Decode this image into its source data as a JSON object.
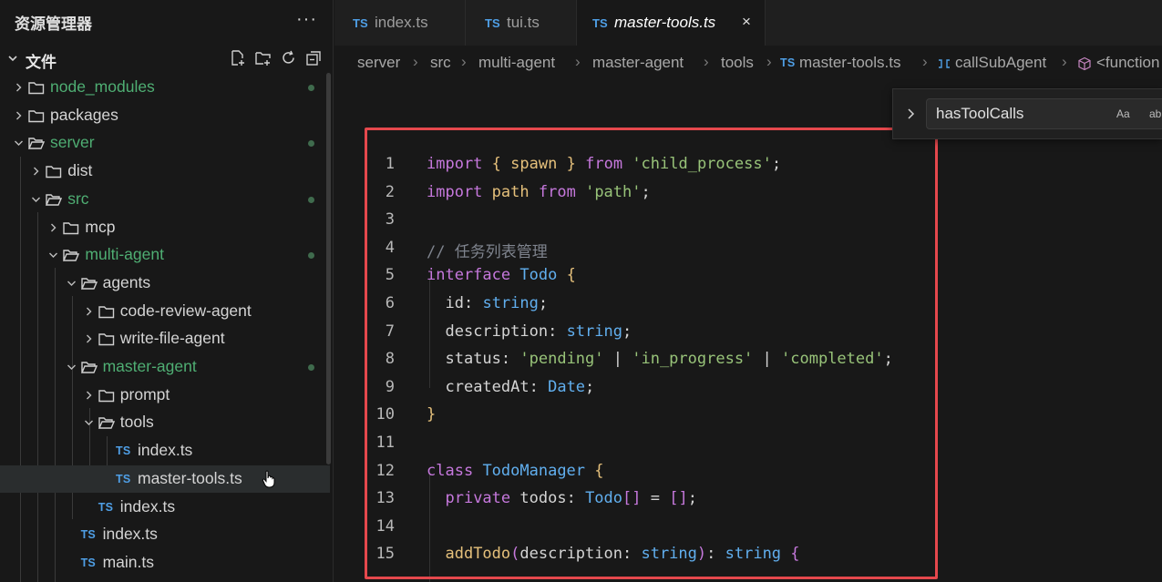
{
  "sidebar": {
    "title": "资源管理器",
    "more": "···",
    "section_label": "文件",
    "items": [
      {
        "label": "node_modules",
        "type": "folder",
        "expanded": false,
        "green": true,
        "dot": true
      },
      {
        "label": "packages",
        "type": "folder",
        "expanded": false,
        "green": false,
        "dot": false
      },
      {
        "label": "server",
        "type": "folder",
        "expanded": true,
        "green": true,
        "dot": true
      },
      {
        "label": "dist",
        "type": "folder",
        "expanded": false,
        "green": false,
        "dot": false
      },
      {
        "label": "src",
        "type": "folder",
        "expanded": true,
        "green": true,
        "dot": true
      },
      {
        "label": "mcp",
        "type": "folder",
        "expanded": false,
        "green": false,
        "dot": false
      },
      {
        "label": "multi-agent",
        "type": "folder",
        "expanded": true,
        "green": true,
        "dot": true
      },
      {
        "label": "agents",
        "type": "folder",
        "expanded": true,
        "green": false,
        "dot": false
      },
      {
        "label": "code-review-agent",
        "type": "folder",
        "expanded": false,
        "green": false,
        "dot": false
      },
      {
        "label": "write-file-agent",
        "type": "folder",
        "expanded": false,
        "green": false,
        "dot": false
      },
      {
        "label": "master-agent",
        "type": "folder",
        "expanded": true,
        "green": true,
        "dot": true
      },
      {
        "label": "prompt",
        "type": "folder",
        "expanded": false,
        "green": false,
        "dot": false
      },
      {
        "label": "tools",
        "type": "folder",
        "expanded": true,
        "green": false,
        "dot": false
      },
      {
        "label": "index.ts",
        "type": "file",
        "badge": "TS"
      },
      {
        "label": "master-tools.ts",
        "type": "file",
        "badge": "TS",
        "selected": true
      },
      {
        "label": "index.ts",
        "type": "file",
        "badge": "TS"
      },
      {
        "label": "index.ts",
        "type": "file",
        "badge": "TS"
      },
      {
        "label": "main.ts",
        "type": "file",
        "badge": "TS"
      }
    ]
  },
  "tabs": [
    {
      "badge": "TS",
      "label": "index.ts",
      "active": false
    },
    {
      "badge": "TS",
      "label": "tui.ts",
      "active": false
    },
    {
      "badge": "TS",
      "label": "master-tools.ts",
      "active": true,
      "close": "×"
    }
  ],
  "breadcrumb": [
    "server",
    "src",
    "multi-agent",
    "master-agent",
    "tools",
    "master-tools.ts",
    "callSubAgent",
    "<function"
  ],
  "breadcrumb_badge": "TS",
  "find": {
    "value": "hasToolCalls",
    "opt_case": "Aa",
    "opt_word": "ab"
  },
  "code": {
    "line_numbers": [
      "1",
      "2",
      "3",
      "4",
      "5",
      "6",
      "7",
      "8",
      "9",
      "10",
      "11",
      "12",
      "13",
      "14",
      "15"
    ],
    "tokens": {
      "import": "import",
      "spawn": "spawn",
      "from": "from",
      "child_process": "'child_process'",
      "path": "path",
      "path_str": "'path'",
      "comment": "// 任务列表管理",
      "interface": "interface",
      "Todo": "Todo",
      "id": "id",
      "string": "string",
      "description": "description",
      "status": "status",
      "pending": "'pending'",
      "in_progress": "'in_progress'",
      "completed": "'completed'",
      "createdAt": "createdAt",
      "Date": "Date",
      "class": "class",
      "TodoManager": "TodoManager",
      "private": "private",
      "todos": "todos",
      "addTodo": "addTodo"
    }
  }
}
